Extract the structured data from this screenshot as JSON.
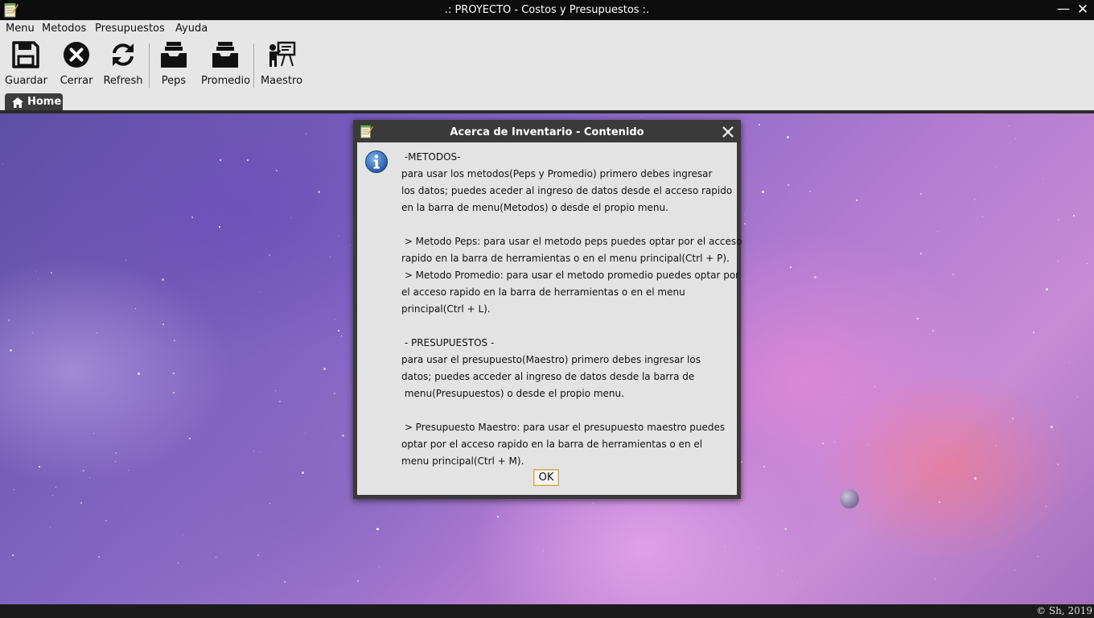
{
  "window": {
    "title": ".: PROYECTO - Costos y Presupuestos :.",
    "minimize_symbol": "—",
    "close_symbol": "✕"
  },
  "menubar": {
    "items": [
      "Menu",
      "Metodos",
      "Presupuestos",
      "Ayuda"
    ]
  },
  "toolbar": {
    "items": [
      {
        "label": "Guardar",
        "icon": "save-icon"
      },
      {
        "label": "Cerrar",
        "icon": "close-circle-icon"
      },
      {
        "label": "Refresh",
        "icon": "refresh-icon"
      },
      {
        "label": "Peps",
        "icon": "inbox-tray-icon"
      },
      {
        "label": "Promedio",
        "icon": "inbox-tray-icon"
      },
      {
        "label": "Maestro",
        "icon": "presenter-board-icon"
      }
    ]
  },
  "tabs": [
    {
      "label": "Home",
      "icon": "home-icon",
      "active": true
    }
  ],
  "dialog": {
    "title": "Acerca de Inventario - Contenido",
    "icon": "info-icon",
    "message": " -METODOS-\npara usar los metodos(Peps y Promedio) primero debes ingresar\nlos datos; puedes aceder al ingreso de datos desde el acceso rapido\nen la barra de menu(Metodos) o desde el propio menu.\n\n > Metodo Peps: para usar el metodo peps puedes optar por el acceso\nrapido en la barra de herramientas o en el menu principal(Ctrl + P).\n > Metodo Promedio: para usar el metodo promedio puedes optar por\nel acceso rapido en la barra de herramientas o en el menu\nprincipal(Ctrl + L).\n\n - PRESUPUESTOS -\npara usar el presupuesto(Maestro) primero debes ingresar los\ndatos; puedes acceder al ingreso de datos desde la barra de\n menu(Presupuestos) o desde el propio menu.\n\n > Presupuesto Maestro: para usar el presupuesto maestro puedes\noptar por el acceso rapido en la barra de herramientas o en el\nmenu principal(Ctrl + M).",
    "ok_label": "OK"
  },
  "statusbar": {
    "copyright": "© Sh, 2019"
  },
  "colors": {
    "titlebar": "#0d0d0d",
    "chrome": "#e6e6e6",
    "dialog_frame": "#3a3a3a",
    "dialog_body": "#e3e3e3",
    "tab_active": "#3c3c3c"
  }
}
